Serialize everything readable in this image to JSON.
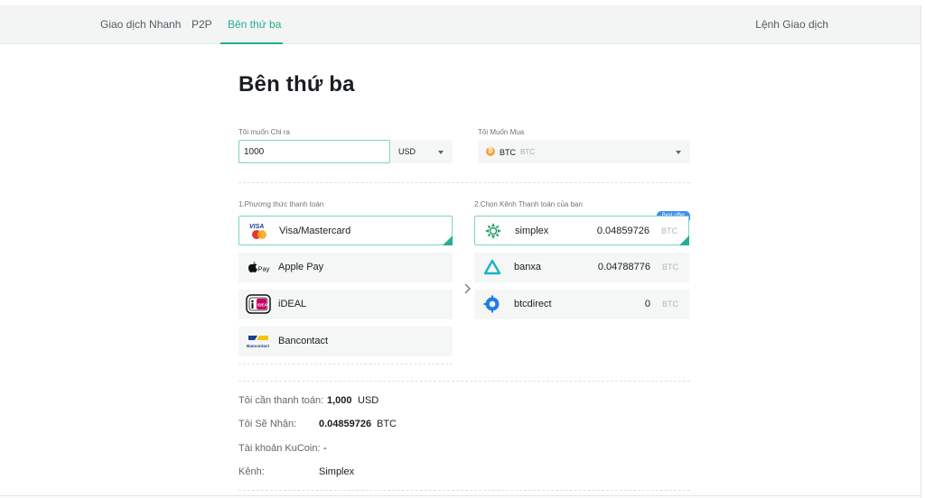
{
  "nav": {
    "tabs": [
      {
        "label": "Giao dịch Nhanh"
      },
      {
        "label": "P2P"
      },
      {
        "label": "Bên thứ ba"
      }
    ],
    "orders_label": "Lệnh Giao dịch"
  },
  "page": {
    "title": "Bên thứ ba"
  },
  "pay": {
    "label": "Tôi muốn Chi ra",
    "amount": "1000",
    "currency": "USD"
  },
  "buy": {
    "label": "Tôi Muốn Mua",
    "code": "BTC",
    "code_secondary": "BTC"
  },
  "methods": {
    "heading": "1.Phương thức thanh toán",
    "items": [
      {
        "label": "Visa/Mastercard",
        "icon": "visa-mastercard-icon",
        "selected": true
      },
      {
        "label": "Apple Pay",
        "icon": "apple-pay-icon",
        "selected": false
      },
      {
        "label": "iDEAL",
        "icon": "ideal-icon",
        "selected": false
      },
      {
        "label": "Bancontact",
        "icon": "bancontact-icon",
        "selected": false
      }
    ]
  },
  "channels": {
    "heading": "2.Chọn Kênh Thanh toán của bạn",
    "best_offer": "Best offer",
    "items": [
      {
        "label": "simplex",
        "amount": "0.04859726",
        "unit": "BTC",
        "icon": "simplex-icon",
        "selected": true
      },
      {
        "label": "banxa",
        "amount": "0.04788776",
        "unit": "BTC",
        "icon": "banxa-icon",
        "selected": false
      },
      {
        "label": "btcdirect",
        "amount": "0",
        "unit": "BTC",
        "icon": "btcdirect-icon",
        "selected": false
      }
    ]
  },
  "summary": {
    "pay_label": "Tôi cần thanh toán:",
    "pay_value": "1,000",
    "pay_unit": "USD",
    "receive_label": "Tôi Sẽ Nhận:",
    "receive_value": "0.04859726",
    "receive_unit": "BTC",
    "account_label": "Tài khoản KuCoin:",
    "account_value": "-",
    "channel_label": "Kênh:",
    "channel_value": "Simplex"
  },
  "colors": {
    "accent": "#23af91",
    "badge": "#3b8ef3",
    "btc": "#f2a33a"
  }
}
